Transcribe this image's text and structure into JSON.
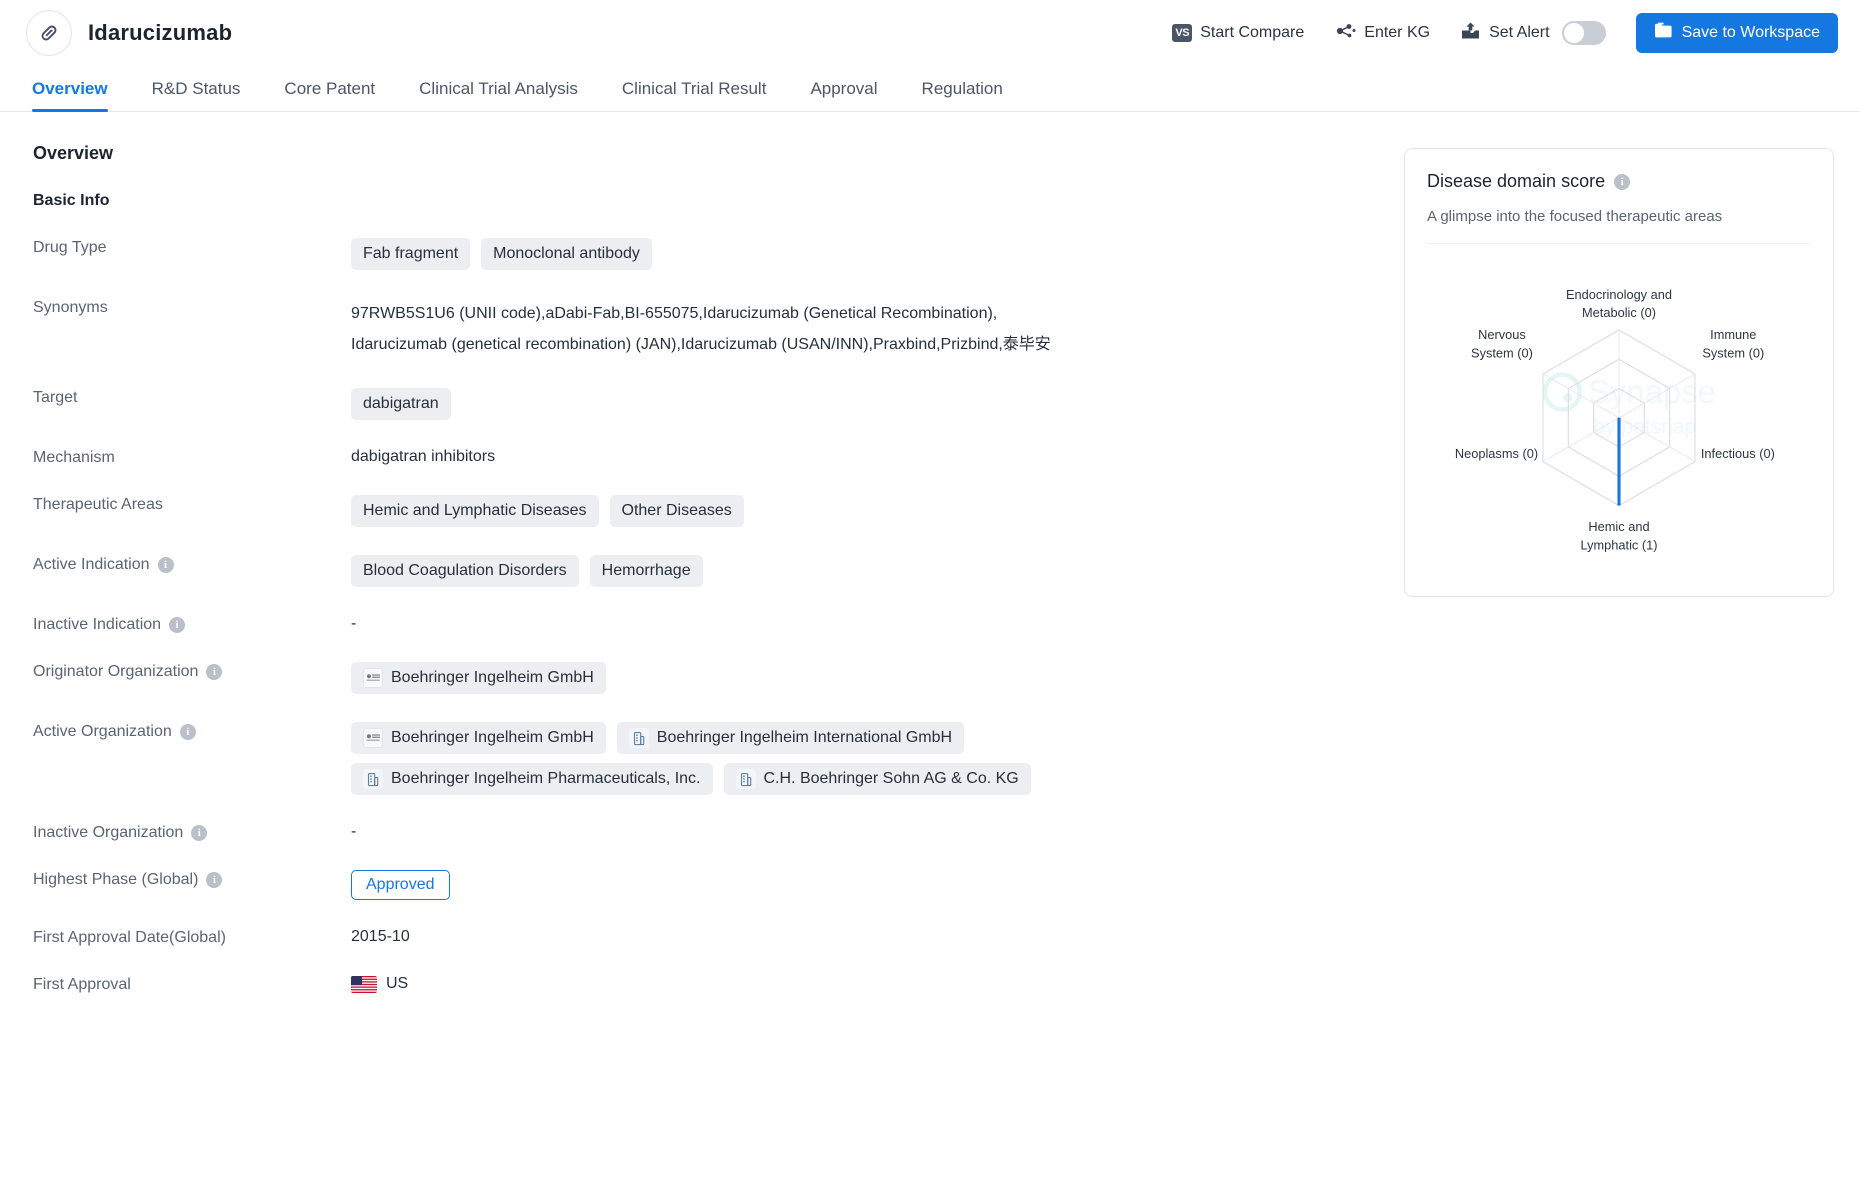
{
  "header": {
    "drug_icon": "pill-icon",
    "title": "Idarucizumab",
    "actions": [
      {
        "icon": "vs-icon",
        "label": "Start Compare",
        "badge": "VS"
      },
      {
        "icon": "knowledge-graph-icon",
        "label": "Enter KG"
      },
      {
        "icon": "alert-inbox-icon",
        "label": "Set Alert",
        "toggle": "off"
      }
    ],
    "save_label": "Save to Workspace",
    "save_icon": "folder-icon",
    "accent_color": "#1578e0"
  },
  "tabs": [
    {
      "label": "Overview",
      "active": true
    },
    {
      "label": "R&D Status",
      "active": false
    },
    {
      "label": "Core Patent",
      "active": false
    },
    {
      "label": "Clinical Trial Analysis",
      "active": false
    },
    {
      "label": "Clinical Trial Result",
      "active": false
    },
    {
      "label": "Approval",
      "active": false
    },
    {
      "label": "Regulation",
      "active": false
    }
  ],
  "overview": {
    "section_title": "Overview",
    "basic_info_title": "Basic Info",
    "rows": {
      "drug_type": {
        "label": "Drug Type",
        "tags": [
          "Fab fragment",
          "Monoclonal antibody"
        ]
      },
      "synonyms": {
        "label": "Synonyms",
        "line1": "97RWB5S1U6 (UNII code),aDabi-Fab,BI-655075,Idarucizumab (Genetical Recombination),",
        "line2": "Idarucizumab (genetical recombination) (JAN),Idarucizumab (USAN/INN),Praxbind,Prizbind,泰毕安"
      },
      "target": {
        "label": "Target",
        "tags": [
          "dabigatran"
        ]
      },
      "mechanism": {
        "label": "Mechanism",
        "value": "dabigatran inhibitors"
      },
      "therapeutic_areas": {
        "label": "Therapeutic Areas",
        "tags": [
          "Hemic and Lymphatic Diseases",
          "Other Diseases"
        ]
      },
      "active_indication": {
        "label": "Active Indication",
        "info": true,
        "tags": [
          "Blood Coagulation Disorders",
          "Hemorrhage"
        ]
      },
      "inactive_indication": {
        "label": "Inactive Indication",
        "info": true,
        "value": "-"
      },
      "originator_organization": {
        "label": "Originator Organization",
        "info": true,
        "tags": [
          {
            "name": "Boehringer Ingelheim GmbH",
            "icon": "company-logo-icon"
          }
        ]
      },
      "active_organization": {
        "label": "Active Organization",
        "info": true,
        "tags": [
          {
            "name": "Boehringer Ingelheim GmbH",
            "icon": "company-logo-icon"
          },
          {
            "name": "Boehringer Ingelheim International GmbH",
            "icon": "building-icon"
          },
          {
            "name": "Boehringer Ingelheim Pharmaceuticals, Inc.",
            "icon": "building-icon"
          },
          {
            "name": "C.H. Boehringer Sohn AG & Co. KG",
            "icon": "building-icon"
          }
        ]
      },
      "inactive_organization": {
        "label": "Inactive Organization",
        "info": true,
        "value": "-"
      },
      "highest_phase": {
        "label": "Highest Phase (Global)",
        "info": true,
        "badge": "Approved"
      },
      "first_approval_date": {
        "label": "First Approval Date(Global)",
        "value": "2015-10"
      },
      "first_approval": {
        "label": "First Approval",
        "country": "US",
        "flag": "us-flag-icon"
      }
    }
  },
  "side_card": {
    "title": "Disease domain score",
    "info": true,
    "subtitle": "A glimpse into the focused therapeutic areas",
    "watermark_line1": "Synapse",
    "watermark_line2": "by patsnap"
  },
  "chart_data": {
    "type": "radar",
    "title": "Disease domain score",
    "categories": [
      "Endocrinology and Metabolic",
      "Immune System",
      "Infectious",
      "Hemic and Lymphatic",
      "Neoplasms",
      "Nervous System"
    ],
    "labels": [
      "Endocrinology and\nMetabolic (0)",
      "Immune\nSystem (0)",
      "Infectious (0)",
      "Hemic and\nLymphatic (1)",
      "Neoplasms (0)",
      "Nervous\nSystem (0)"
    ],
    "values": [
      0,
      0,
      0,
      1,
      0,
      0
    ],
    "rmax": 1,
    "rings": 3,
    "grid": true,
    "legend": "none",
    "series_color": "#1578e0",
    "grid_color": "#dcdfe4"
  }
}
